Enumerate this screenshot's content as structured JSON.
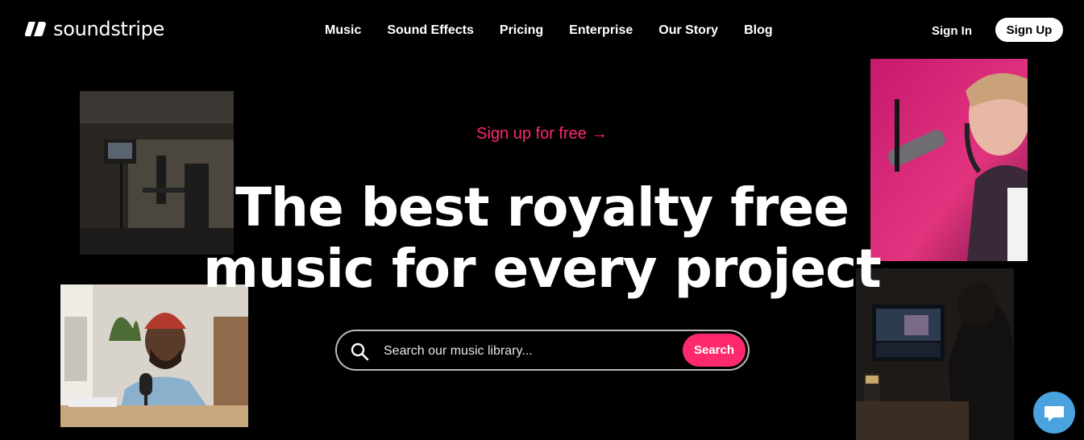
{
  "header": {
    "logo_text": "soundstripe",
    "nav": [
      {
        "label": "Music"
      },
      {
        "label": "Sound Effects"
      },
      {
        "label": "Pricing"
      },
      {
        "label": "Enterprise"
      },
      {
        "label": "Our Story"
      },
      {
        "label": "Blog"
      }
    ],
    "signin_label": "Sign In",
    "signup_label": "Sign Up"
  },
  "hero": {
    "cta_label": "Sign up for free",
    "cta_arrow": "→",
    "headline_line1": "The best royalty free",
    "headline_line2": "music for every project"
  },
  "search": {
    "placeholder": "Search our music library...",
    "value": "",
    "button_label": "Search"
  },
  "icons": {
    "logo": "soundstripe-logo-icon",
    "search": "search-icon",
    "chat": "chat-bubble-icon"
  },
  "colors": {
    "accent": "#ff2a6d",
    "background": "#000000",
    "chat": "#4aa3df"
  }
}
